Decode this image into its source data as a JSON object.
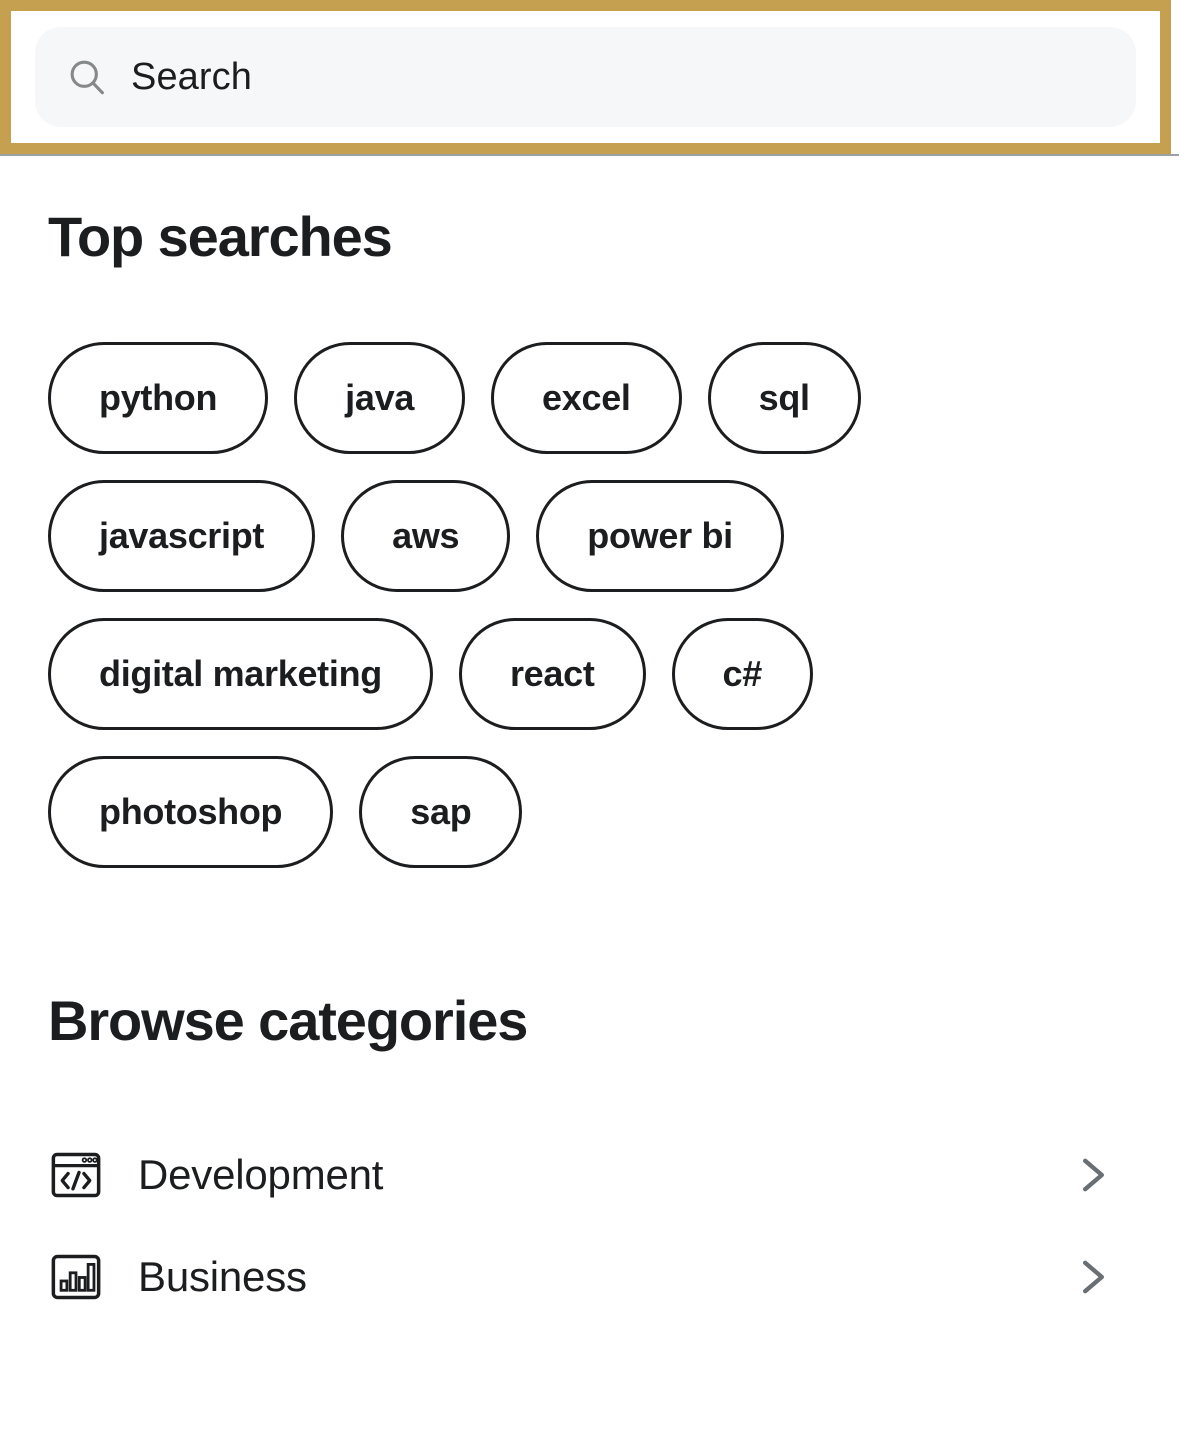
{
  "theme": {
    "focus_ring_color": "#C4A050",
    "text_color": "#1C1D1F",
    "field_background": "#F6F7F8",
    "chevron_color": "#6A6F73",
    "page_background": "#FFFFFF"
  },
  "search": {
    "placeholder": "Search",
    "value": "",
    "icon": "search-icon"
  },
  "top_searches": {
    "title": "Top searches",
    "pills": [
      {
        "label": "python"
      },
      {
        "label": "java"
      },
      {
        "label": "excel"
      },
      {
        "label": "sql"
      },
      {
        "label": "javascript"
      },
      {
        "label": "aws"
      },
      {
        "label": "power bi"
      },
      {
        "label": "digital marketing"
      },
      {
        "label": "react"
      },
      {
        "label": "c#"
      },
      {
        "label": "photoshop"
      },
      {
        "label": "sap"
      }
    ]
  },
  "browse_categories": {
    "title": "Browse categories",
    "items": [
      {
        "label": "Development",
        "icon": "code-window-icon",
        "chevron": "chevron-right-icon"
      },
      {
        "label": "Business",
        "icon": "bar-chart-icon",
        "chevron": "chevron-right-icon"
      }
    ]
  }
}
